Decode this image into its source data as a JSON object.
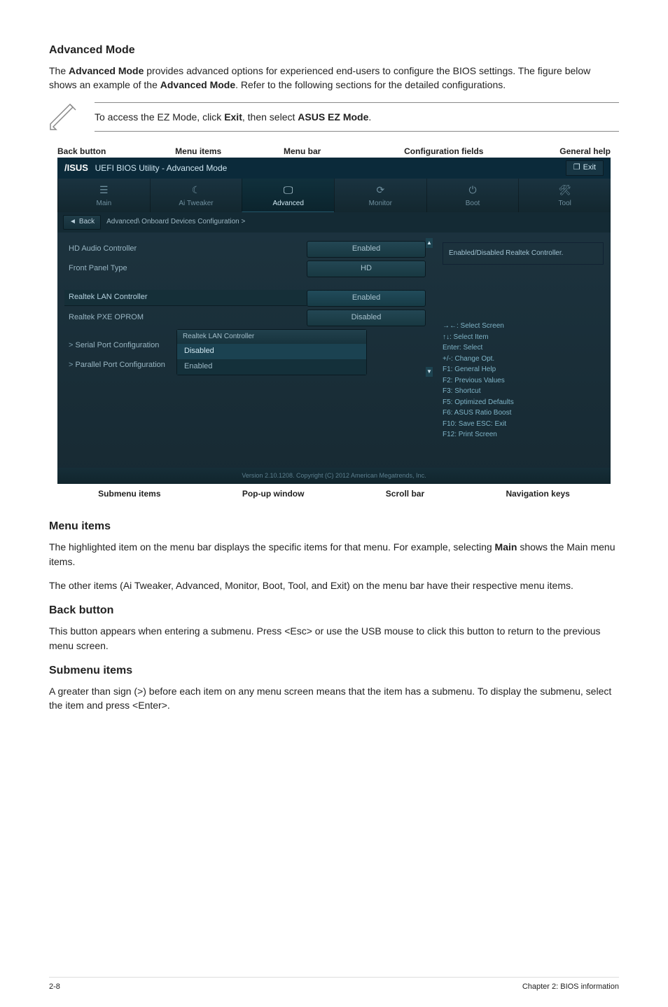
{
  "section": {
    "advanced_mode_title": "Advanced Mode",
    "advanced_mode_body": "The Advanced Mode provides advanced options for experienced end-users to configure the BIOS settings. The figure below shows an example of the Advanced Mode. Refer to the following sections for the detailed configurations.",
    "note_text_pre": "To access the EZ Mode, click ",
    "note_exit": "Exit",
    "note_mid": ", then select ",
    "note_ezmode": "ASUS EZ Mode",
    "note_end": ".",
    "menu_items_title": "Menu items",
    "menu_items_body1": "The highlighted item on the menu bar displays the specific items for that menu. For example, selecting Main shows the Main menu items.",
    "menu_items_body2": "The other items (Ai Tweaker, Advanced, Monitor, Boot, Tool, and Exit) on the menu bar have their respective menu items.",
    "back_button_title": "Back button",
    "back_button_body": "This button appears when entering a submenu. Press <Esc> or use the USB mouse to click this button to return to the previous menu screen.",
    "submenu_title": "Submenu items",
    "submenu_body": "A greater than sign (>) before each item on any menu screen means that the item has a submenu. To display the submenu, select the item and press <Enter>."
  },
  "callouts": {
    "back_button": "Back button",
    "menu_items": "Menu items",
    "menu_bar": "Menu bar",
    "config_fields": "Configuration fields",
    "general_help": "General help",
    "submenu_items": "Submenu items",
    "popup_window": "Pop-up window",
    "scroll_bar": "Scroll bar",
    "nav_keys": "Navigation keys"
  },
  "bios": {
    "title_brand": "UEFI BIOS Utility - Advanced Mode",
    "exit": "Exit",
    "tabs": [
      "Main",
      "Ai Tweaker",
      "Advanced",
      "Monitor",
      "Boot",
      "Tool"
    ],
    "breadcrumb_back": "Back",
    "breadcrumb_path": "Advanced\\ Onboard Devices Configuration  >",
    "rows": [
      {
        "label": "HD Audio Controller",
        "value": "Enabled",
        "style": "pill"
      },
      {
        "label": "Front Panel Type",
        "value": "HD",
        "style": "pill"
      },
      {
        "label": "Realtek LAN Controller",
        "value": "Enabled",
        "style": "pill sel",
        "highlight": true
      },
      {
        "label": "Realtek PXE OPROM",
        "value": "Disabled",
        "style": "pill"
      }
    ],
    "subitems": [
      "Serial Port Configuration",
      "Parallel Port Configuration"
    ],
    "popup": {
      "title": "Realtek LAN Controller",
      "options": [
        "Disabled",
        "Enabled"
      ]
    },
    "help_text": "Enabled/Disabled Realtek Controller.",
    "nav_lines": [
      "→←: Select Screen",
      "↑↓: Select Item",
      "Enter: Select",
      "+/-: Change Opt.",
      "F1: General Help",
      "F2: Previous Values",
      "F3: Shortcut",
      "F5: Optimized Defaults",
      "F6: ASUS Ratio Boost",
      "F10: Save   ESC: Exit",
      "F12: Print Screen"
    ],
    "footer": "Version 2.10.1208.  Copyright (C) 2012 American Megatrends, Inc."
  },
  "page_footer": {
    "left": "2-8",
    "right": "Chapter 2: BIOS information"
  }
}
